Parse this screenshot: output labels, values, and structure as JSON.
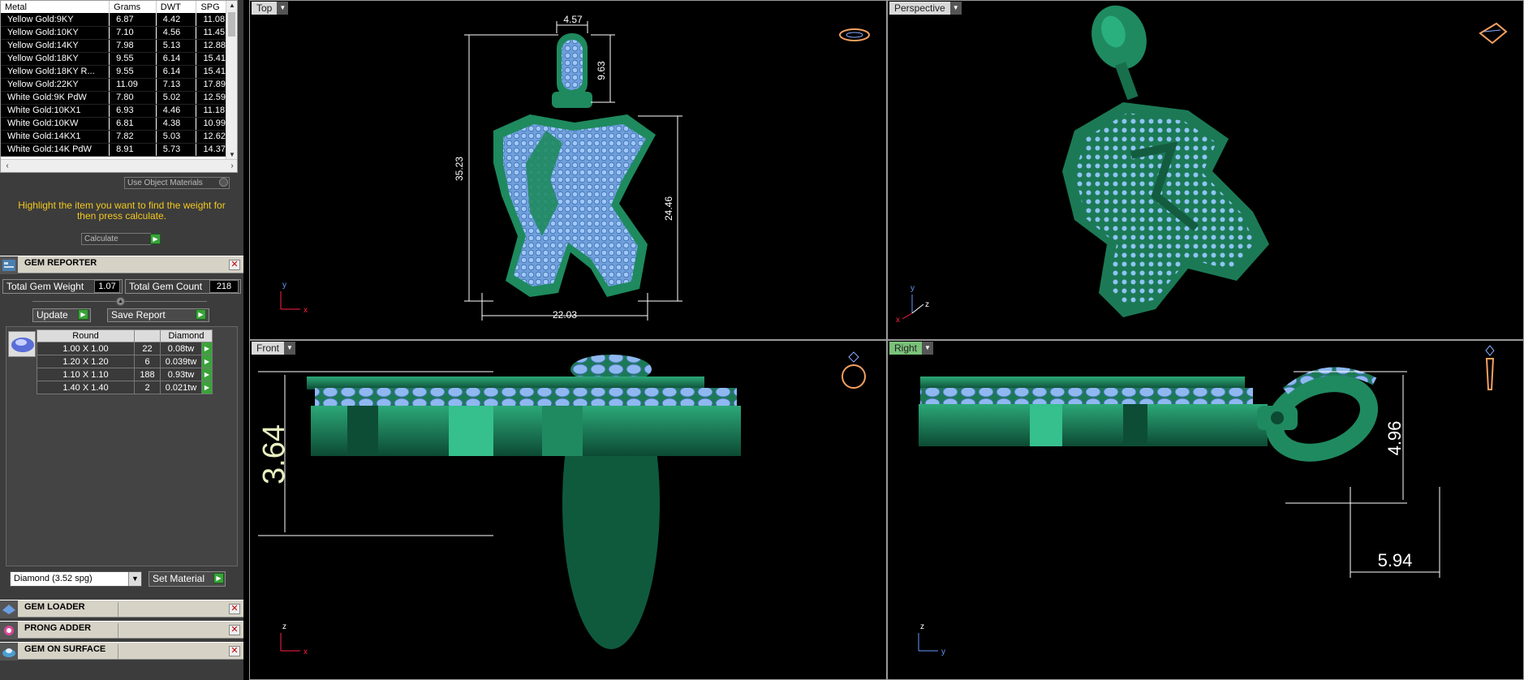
{
  "metal_table": {
    "headers": [
      "Metal",
      "Grams",
      "DWT",
      "SPG"
    ],
    "rows": [
      [
        "Yellow Gold:9KY",
        "6.87",
        "4.42",
        "11.08"
      ],
      [
        "Yellow Gold:10KY",
        "7.10",
        "4.56",
        "11.45"
      ],
      [
        "Yellow Gold:14KY",
        "7.98",
        "5.13",
        "12.88"
      ],
      [
        "Yellow Gold:18KY",
        "9.55",
        "6.14",
        "15.41"
      ],
      [
        "Yellow Gold:18KY R...",
        "9.55",
        "6.14",
        "15.41"
      ],
      [
        "Yellow Gold:22KY",
        "11.09",
        "7.13",
        "17.89"
      ],
      [
        "White Gold:9K PdW",
        "7.80",
        "5.02",
        "12.59"
      ],
      [
        "White Gold:10KX1",
        "6.93",
        "4.46",
        "11.18"
      ],
      [
        "White Gold:10KW",
        "6.81",
        "4.38",
        "10.99"
      ],
      [
        "White Gold:14KX1",
        "7.82",
        "5.03",
        "12.62"
      ],
      [
        "White Gold:14K PdW",
        "8.91",
        "5.73",
        "14.37"
      ]
    ]
  },
  "use_object_materials": "Use Object Materials",
  "instructions": "Highlight the item you want to find the weight for then press calculate.",
  "calculate_label": "Calculate",
  "gem_reporter": {
    "title": "GEM REPORTER",
    "total_gem_weight_label": "Total Gem Weight",
    "total_gem_weight": "1.07",
    "total_gem_count_label": "Total Gem Count",
    "total_gem_count": "218",
    "update_label": "Update",
    "save_report_label": "Save Report",
    "gem_headers": [
      "Round",
      "",
      "Diamond"
    ],
    "gems": [
      {
        "size": "1.00 X 1.00",
        "count": "22",
        "weight": "0.08tw"
      },
      {
        "size": "1.20 X 1.20",
        "count": "6",
        "weight": "0.039tw"
      },
      {
        "size": "1.10 X 1.10",
        "count": "188",
        "weight": "0.93tw"
      },
      {
        "size": "1.40 X 1.40",
        "count": "2",
        "weight": "0.021tw"
      }
    ],
    "material_select": "Diamond    (3.52 spg)",
    "set_material_label": "Set Material"
  },
  "panels": {
    "gem_loader": "GEM LOADER",
    "prong_adder": "PRONG ADDER",
    "gem_on_surface": "GEM ON SURFACE"
  },
  "viewports": {
    "top": {
      "label": "Top",
      "dims": [
        "4.57",
        "9.63",
        "35.23",
        "24.46",
        "22.03"
      ],
      "axis": [
        "y",
        "x"
      ]
    },
    "perspective": {
      "label": "Perspective",
      "axis": [
        "y",
        "z",
        "x"
      ]
    },
    "front": {
      "label": "Front",
      "dims": [
        "3.64"
      ],
      "axis": [
        "z",
        "x"
      ]
    },
    "right": {
      "label": "Right",
      "dims": [
        "4.96",
        "5.94"
      ],
      "axis": [
        "z",
        "y"
      ]
    }
  },
  "colors": {
    "model_green": "#1e8a5e",
    "gem_blue": "#8fb8f0",
    "dimension_white": "#ffffff",
    "active_label": "#7ac27a",
    "instruction_yellow": "#f3c820"
  }
}
